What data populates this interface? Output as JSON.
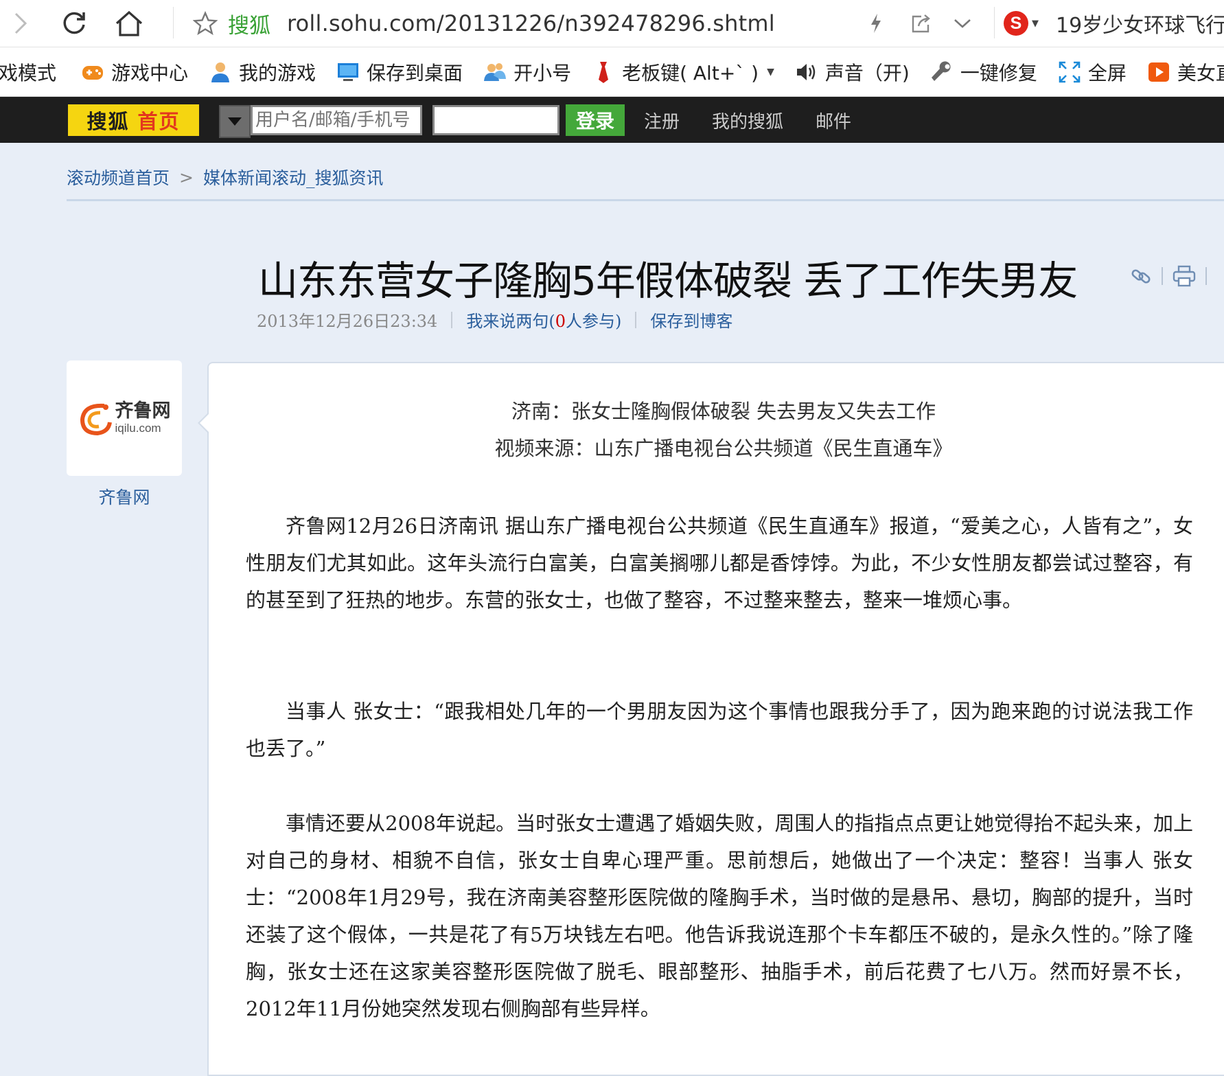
{
  "browser": {
    "brand": "搜狐",
    "url": "roll.sohu.com/20131226/n392478296.shtml",
    "search_hint": "19岁少女环球飞行"
  },
  "toolbar": {
    "items": [
      {
        "label": "戏模式",
        "icon": "game-mode"
      },
      {
        "label": "游戏中心",
        "icon": "gamepad-icon"
      },
      {
        "label": "我的游戏",
        "icon": "user-icon"
      },
      {
        "label": "保存到桌面",
        "icon": "monitor-icon"
      },
      {
        "label": "开小号",
        "icon": "users-icon"
      },
      {
        "label": "老板键( Alt+` )",
        "icon": "tie-icon"
      },
      {
        "label": "声音（开)",
        "icon": "speaker-icon"
      },
      {
        "label": "一键修复",
        "icon": "wrench-icon"
      },
      {
        "label": "全屏",
        "icon": "fullscreen-icon"
      },
      {
        "label": "美女直",
        "icon": "play-icon"
      }
    ]
  },
  "sohu_bar": {
    "logo_main": "搜狐",
    "logo_sub": "首页",
    "username_placeholder": "用户名/邮箱/手机号",
    "login_label": "登录",
    "links": [
      "注册",
      "我的搜狐",
      "邮件"
    ]
  },
  "breadcrumb": {
    "home": "滚动频道首页",
    "separator": ">",
    "current": "媒体新闻滚动_搜狐资讯"
  },
  "article": {
    "title": "山东东营女子隆胸5年假体破裂 丢了工作失男友",
    "date": "2013年12月26日23:34",
    "comment_prefix": "我来说两句(",
    "comment_count": "0",
    "comment_suffix": "人参与)",
    "save_blog": "保存到博客",
    "source_logo_main": "齐鲁网",
    "source_logo_sub": "iqilu.com",
    "source_name": "齐鲁网",
    "caption1": "济南：张女士隆胸假体破裂  失去男友又失去工作",
    "caption2": "视频来源：山东广播电视台公共频道《民生直通车》",
    "paragraphs": [
      "齐鲁网12月26日济南讯 据山东广播电视台公共频道《民生直通车》报道，“爱美之心，人皆有之”，女性朋友们尤其如此。这年头流行白富美，白富美搁哪儿都是香饽饽。为此，不少女性朋友都尝试过整容，有的甚至到了狂热的地步。东营的张女士，也做了整容，不过整来整去，整来一堆烦心事。",
      "当事人 张女士：“跟我相处几年的一个男朋友因为这个事情也跟我分手了，因为跑来跑的讨说法我工作也丢了。”",
      "事情还要从2008年说起。当时张女士遭遇了婚姻失败，周围人的指指点点更让她觉得抬不起头来，加上对自己的身材、相貌不自信，张女士自卑心理严重。思前想后，她做出了一个决定：整容！当事人 张女士：“2008年1月29号，我在济南美容整形医院做的隆胸手术，当时做的是悬吊、悬切，胸部的提升，当时还装了这个假体，一共是花了有5万块钱左右吧。他告诉我说连那个卡车都压不破的，是永久性的。”除了隆胸，张女士还在这家美容整形医院做了脱毛、眼部整形、抽脂手术，前后花费了七八万。然而好景不长，2012年11月份她突然发现右侧胸部有些异样。"
    ]
  },
  "colors": {
    "page_bg": "#e8eef7",
    "sohu_yellow": "#f5d511",
    "sohu_bar": "#1e1e1e",
    "login_green": "#44a83a",
    "link_blue": "#2a5e9c",
    "brand_green": "#3aa236"
  }
}
